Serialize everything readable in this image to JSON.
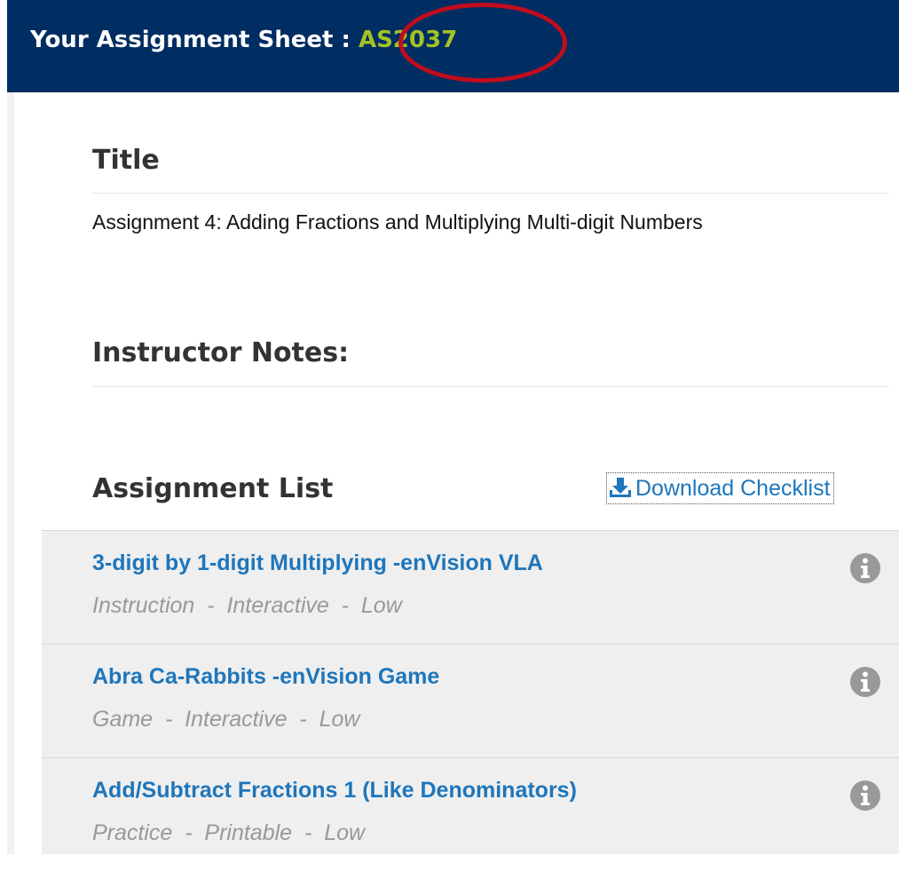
{
  "header": {
    "label": "Your Assignment Sheet : ",
    "sheet_id": "AS2037",
    "background": "#002d62",
    "id_color": "#a2c226",
    "callout_color": "#c00d1e"
  },
  "title_section": {
    "heading": "Title",
    "value": "Assignment 4: Adding Fractions and Multiplying Multi-digit Numbers"
  },
  "notes_section": {
    "heading": "Instructor Notes:",
    "value": ""
  },
  "assignment_list": {
    "heading": "Assignment List",
    "download_label": "Download Checklist",
    "download_icon": "download-icon",
    "info_icon": "info-icon",
    "link_color": "#1e76bb",
    "items": [
      {
        "title": "3-digit by 1-digit Multiplying -enVision VLA",
        "meta": "Instruction  -  Interactive  -  Low"
      },
      {
        "title": "Abra Ca-Rabbits -enVision Game",
        "meta": "Game  -  Interactive  -  Low"
      },
      {
        "title": "Add/Subtract Fractions 1 (Like Denominators)",
        "meta": "Practice  -  Printable  -  Low"
      }
    ]
  }
}
